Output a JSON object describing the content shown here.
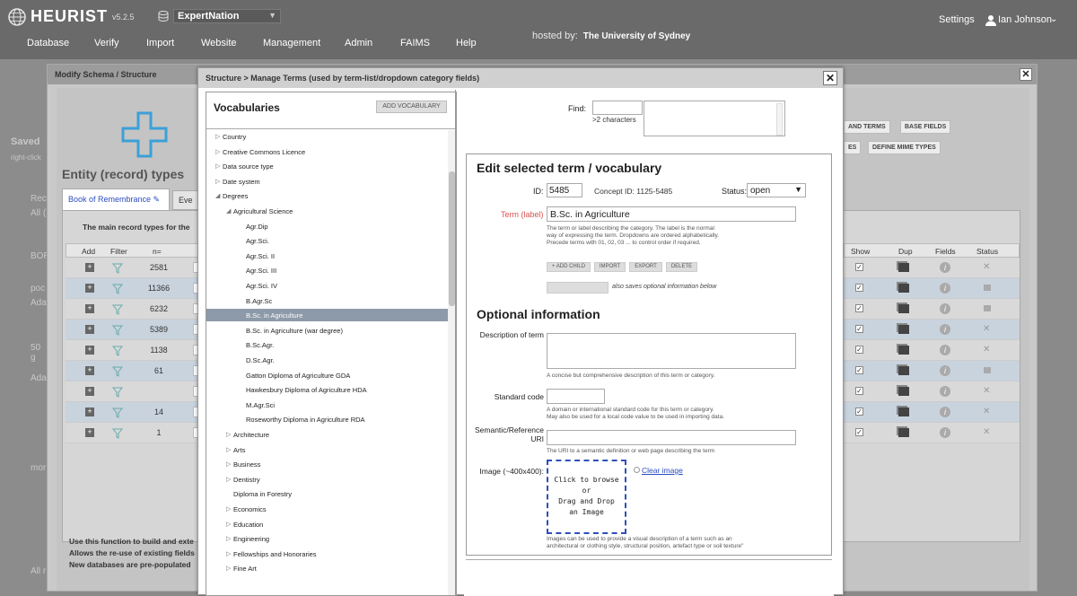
{
  "app": {
    "name": "HEURIST",
    "version": "v5.2.5",
    "database": "ExpertNation",
    "settings": "Settings",
    "user": "Ian Johnson",
    "hosted_by_label": "hosted by:",
    "hosted_by_value": "The University of Sydney"
  },
  "menu": [
    "Database",
    "Verify",
    "Import",
    "Website",
    "Management",
    "Admin",
    "FAIMS",
    "Help"
  ],
  "modify_schema": {
    "title": "Modify Schema / Structure",
    "entity_heading": "Entity (record) types",
    "tabs": [
      "Book of Remembrance ✎",
      "Eve"
    ],
    "description": "The main record types for the",
    "right_buttons": [
      "AND TERMS",
      "BASE FIELDS",
      "ES",
      "DEFINE MIME TYPES"
    ],
    "table_headers": [
      "Add",
      "Filter",
      "n=",
      "Show",
      "Dup",
      "Fields",
      "Status"
    ],
    "rows": [
      {
        "n": "2581",
        "status": "x"
      },
      {
        "n": "11366",
        "status": "lock"
      },
      {
        "n": "6232",
        "status": "lock"
      },
      {
        "n": "5389",
        "status": "x"
      },
      {
        "n": "1138",
        "status": "x"
      },
      {
        "n": "61",
        "status": "lock"
      },
      {
        "n": "",
        "status": "x"
      },
      {
        "n": "14",
        "status": "x"
      },
      {
        "n": "1",
        "status": "x"
      }
    ],
    "footer_lines": [
      "Use this function to build and exte",
      "Allows the re-use of existing fields",
      "New databases are pre-populated"
    ]
  },
  "sidebar_bg": [
    "Saved",
    "right-click",
    "Rec",
    "All (",
    "BOR",
    "poc",
    "Ada",
    "50 g",
    "Ada",
    "mor",
    "All r"
  ],
  "manage_terms": {
    "title": "Structure > Manage Terms (used by term-list/dropdown category fields)",
    "vocab_heading": "Vocabularies",
    "add_vocab": "ADD VOCABULARY",
    "tree": [
      {
        "label": "Country",
        "level": 0,
        "arrow": "closed"
      },
      {
        "label": "Creative Commons Licence",
        "level": 0,
        "arrow": "closed"
      },
      {
        "label": "Data source type",
        "level": 0,
        "arrow": "closed"
      },
      {
        "label": "Date system",
        "level": 0,
        "arrow": "closed"
      },
      {
        "label": "Degrees",
        "level": 0,
        "arrow": "open"
      },
      {
        "label": "Agricultural Science",
        "level": 1,
        "arrow": "open"
      },
      {
        "label": "Agr.Dip",
        "level": 2,
        "arrow": "none"
      },
      {
        "label": "Agr.Sci.",
        "level": 2,
        "arrow": "none"
      },
      {
        "label": "Agr.Sci. II",
        "level": 2,
        "arrow": "none"
      },
      {
        "label": "Agr.Sci. III",
        "level": 2,
        "arrow": "none"
      },
      {
        "label": "Agr.Sci. IV",
        "level": 2,
        "arrow": "none"
      },
      {
        "label": "B.Agr.Sc",
        "level": 2,
        "arrow": "none"
      },
      {
        "label": "B.Sc. in Agriculture",
        "level": 2,
        "arrow": "none",
        "selected": true
      },
      {
        "label": "B.Sc. in Agriculture (war degree)",
        "level": 2,
        "arrow": "none"
      },
      {
        "label": "B.Sc.Agr.",
        "level": 2,
        "arrow": "none"
      },
      {
        "label": "D.Sc.Agr.",
        "level": 2,
        "arrow": "none"
      },
      {
        "label": "Gatton Diploma of Agriculture GDA",
        "level": 2,
        "arrow": "none"
      },
      {
        "label": "Hawkesbury Diploma of Agriculture HDA",
        "level": 2,
        "arrow": "none"
      },
      {
        "label": "M.Agr.Sci",
        "level": 2,
        "arrow": "none"
      },
      {
        "label": "Roseworthy Diploma in Agriculture RDA",
        "level": 2,
        "arrow": "none"
      },
      {
        "label": "Architecture",
        "level": 1,
        "arrow": "closed"
      },
      {
        "label": "Arts",
        "level": 1,
        "arrow": "closed"
      },
      {
        "label": "Business",
        "level": 1,
        "arrow": "closed"
      },
      {
        "label": "Dentistry",
        "level": 1,
        "arrow": "closed"
      },
      {
        "label": "Diploma in Forestry",
        "level": 1,
        "arrow": "none"
      },
      {
        "label": "Economics",
        "level": 1,
        "arrow": "closed"
      },
      {
        "label": "Education",
        "level": 1,
        "arrow": "closed"
      },
      {
        "label": "Engineering",
        "level": 1,
        "arrow": "closed"
      },
      {
        "label": "Fellowships and Honoraries",
        "level": 1,
        "arrow": "closed"
      },
      {
        "label": "Fine Art",
        "level": 1,
        "arrow": "closed"
      }
    ],
    "find_label": "Find:",
    "find_hint": ">2 characters",
    "edit_heading": "Edit selected term / vocabulary",
    "id_label": "ID:",
    "id_value": "5485",
    "concept_id": "Concept ID: 1125-5485",
    "status_label": "Status:",
    "status_value": "open",
    "term_label": "Term (label)",
    "term_value": "B.Sc. in Agriculture",
    "term_help": [
      "The term or label describing the category. The label is the normal",
      "way of expressing the term. Dropdowns are ordered alphabetically.",
      "Precede terms with 01, 02, 03 ... to control order if required."
    ],
    "buttons": [
      "+ ADD CHILD",
      "IMPORT",
      "EXPORT",
      "DELETE"
    ],
    "save_note": "also saves optional information below",
    "optional_heading": "Optional information",
    "desc_label": "Description of term",
    "desc_help": "A concise but comprehensive description of this term or category.",
    "std_label": "Standard code",
    "std_help": [
      "A domain or international standard code for this term or category.",
      "May also be used for a local code value to be used in importing data."
    ],
    "uri_label_1": "Semantic/Reference",
    "uri_label_2": "URI",
    "uri_help": "The URI to a semantic definition or web page describing the term",
    "image_label": "Image (~400x400):",
    "image_drop": [
      "Click to browse",
      "or",
      "Drag and Drop",
      "an Image"
    ],
    "clear_image": "Clear image",
    "image_help": [
      "Images can be used to provide a visual description of a term such as an",
      "architectural or clothing style, structural position, artefact type or soil texture\""
    ]
  },
  "colors": {
    "topbar": "#6a6a6a",
    "selected_row": "#8d9aa9",
    "required": "#d9534f",
    "link": "#2a4cc0",
    "accent_plus": "#3ba0d8"
  }
}
